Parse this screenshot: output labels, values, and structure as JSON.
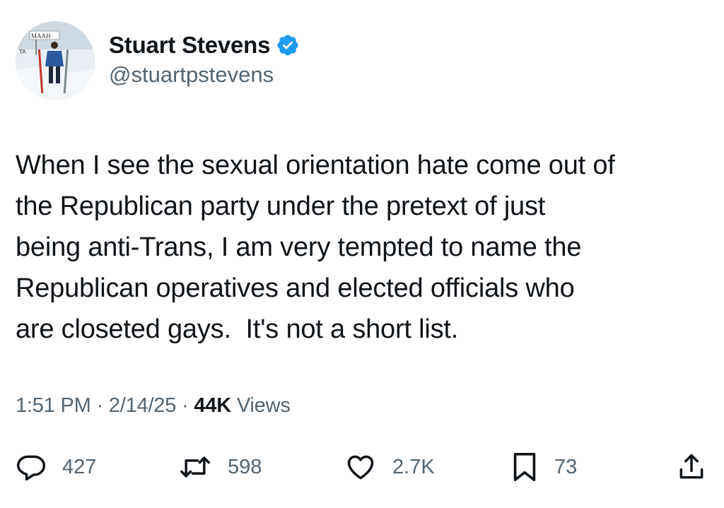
{
  "author": {
    "display_name": "Stuart Stevens",
    "handle": "@stuartpstevens",
    "verified": true,
    "avatar_sign_text": "MAAH",
    "avatar_sign_text_2": "TA"
  },
  "tweet": {
    "text": "When I see the sexual orientation hate come out of\nthe Republican party under the pretext of just\nbeing anti-Trans, I am very tempted to name the\nRepublican operatives and elected officials who\nare closeted gays.  It's not a short list.",
    "time": "1:51 PM",
    "date": "2/14/25",
    "views_count": "44K",
    "views_label": "Views",
    "separator": "·"
  },
  "actions": {
    "replies": "427",
    "reposts": "598",
    "likes": "2.7K",
    "bookmarks": "73"
  },
  "colors": {
    "text": "#0f1419",
    "secondary": "#536471",
    "verified": "#1d9bf0"
  },
  "icons": [
    "verified-badge-icon",
    "reply-icon",
    "repost-icon",
    "like-icon",
    "bookmark-icon",
    "share-icon"
  ]
}
